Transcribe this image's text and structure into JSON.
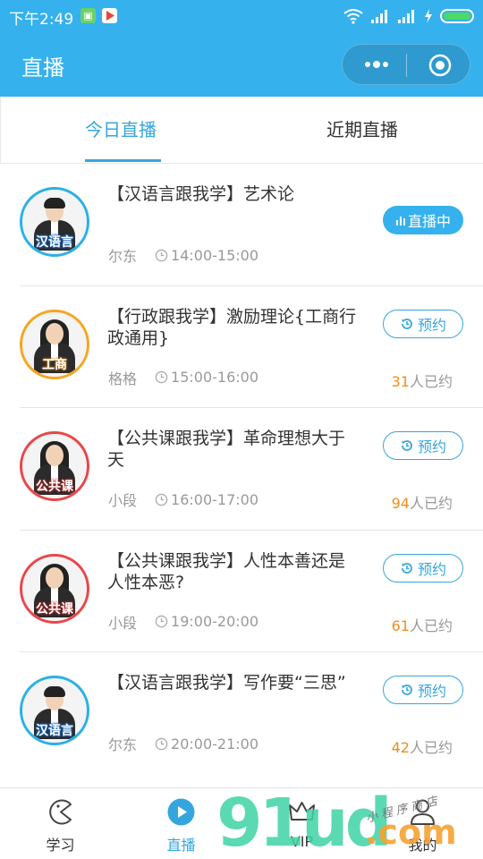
{
  "status_bar": {
    "time": "下午2:49",
    "battery_color": "#4CD964"
  },
  "header": {
    "title": "直播",
    "background": "#35B1EE",
    "menu_icon": "more-dots-icon",
    "close_icon": "target-circle-icon"
  },
  "tabs": [
    {
      "label": "今日直播",
      "active": true
    },
    {
      "label": "近期直播",
      "active": false
    }
  ],
  "sessions": [
    {
      "title": "【汉语言跟我学】艺术论",
      "teacher": "尔东",
      "time": "14:00-15:00",
      "avatar_tag": "汉语言",
      "status": "live",
      "action_label": "直播中",
      "booked_count": "",
      "booked_suffix": ""
    },
    {
      "title": "【行政跟我学】激励理论{工商行政通用}",
      "teacher": "格格",
      "time": "15:00-16:00",
      "avatar_tag": "工商",
      "status": "upcoming",
      "action_label": "预约",
      "booked_count": "31",
      "booked_suffix": "人已约"
    },
    {
      "title": "【公共课跟我学】革命理想大于天",
      "teacher": "小段",
      "time": "16:00-17:00",
      "avatar_tag": "公共课",
      "status": "upcoming",
      "action_label": "预约",
      "booked_count": "94",
      "booked_suffix": "人已约"
    },
    {
      "title": "【公共课跟我学】人性本善还是人性本恶?",
      "teacher": "小段",
      "time": "19:00-20:00",
      "avatar_tag": "公共课",
      "status": "upcoming",
      "action_label": "预约",
      "booked_count": "61",
      "booked_suffix": "人已约"
    },
    {
      "title": "【汉语言跟我学】写作要“三思”",
      "teacher": "尔东",
      "time": "20:00-21:00",
      "avatar_tag": "汉语言",
      "status": "upcoming",
      "action_label": "预约",
      "booked_count": "42",
      "booked_suffix": "人已约"
    }
  ],
  "bottom_nav": [
    {
      "label": "学习",
      "icon": "pacman-icon",
      "active": false
    },
    {
      "label": "直播",
      "icon": "play-circle-icon",
      "active": true
    },
    {
      "label": "VIP",
      "icon": "crown-icon",
      "active": false
    },
    {
      "label": "我的",
      "icon": "user-icon",
      "active": false
    }
  ],
  "watermark": {
    "main": "91ud",
    "suffix": ".com",
    "small": "小 程 序 商 店"
  },
  "colors": {
    "accent": "#35A6DD",
    "booked_number": "#F28C1B",
    "muted_text": "#999999"
  }
}
